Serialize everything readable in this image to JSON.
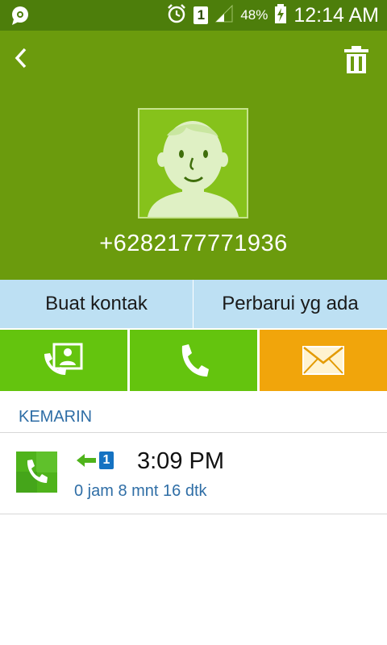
{
  "status_bar": {
    "battery_percent": "48%",
    "time": "12:14 AM",
    "sim_slot": "1",
    "icons": [
      "chat-bubble-icon",
      "alarm-icon",
      "sim-icon",
      "signal-icon",
      "battery-charging-icon"
    ]
  },
  "header": {
    "back_icon": "chevron-left-icon",
    "delete_icon": "trash-icon",
    "phone_number": "+6282177771936",
    "colors": {
      "background": "#6b9b0d",
      "statusbar": "#4d7e0b",
      "avatar_bg": "#86c21b"
    }
  },
  "contact_actions": {
    "create_label": "Buat kontak",
    "update_label": "Perbarui yg ada"
  },
  "quick_actions": [
    {
      "name": "contacts",
      "icon": "contact-card-phone-icon",
      "color": "#64c40e"
    },
    {
      "name": "call",
      "icon": "phone-icon",
      "color": "#64c40e"
    },
    {
      "name": "message",
      "icon": "envelope-icon",
      "color": "#f1a50b"
    }
  ],
  "call_log": {
    "section_label": "KEMARIN",
    "items": [
      {
        "time": "3:09 PM",
        "duration": "0 jam 8 mnt 16 dtk",
        "sim": "1",
        "direction_icon": "incoming-arrow-icon"
      }
    ]
  }
}
